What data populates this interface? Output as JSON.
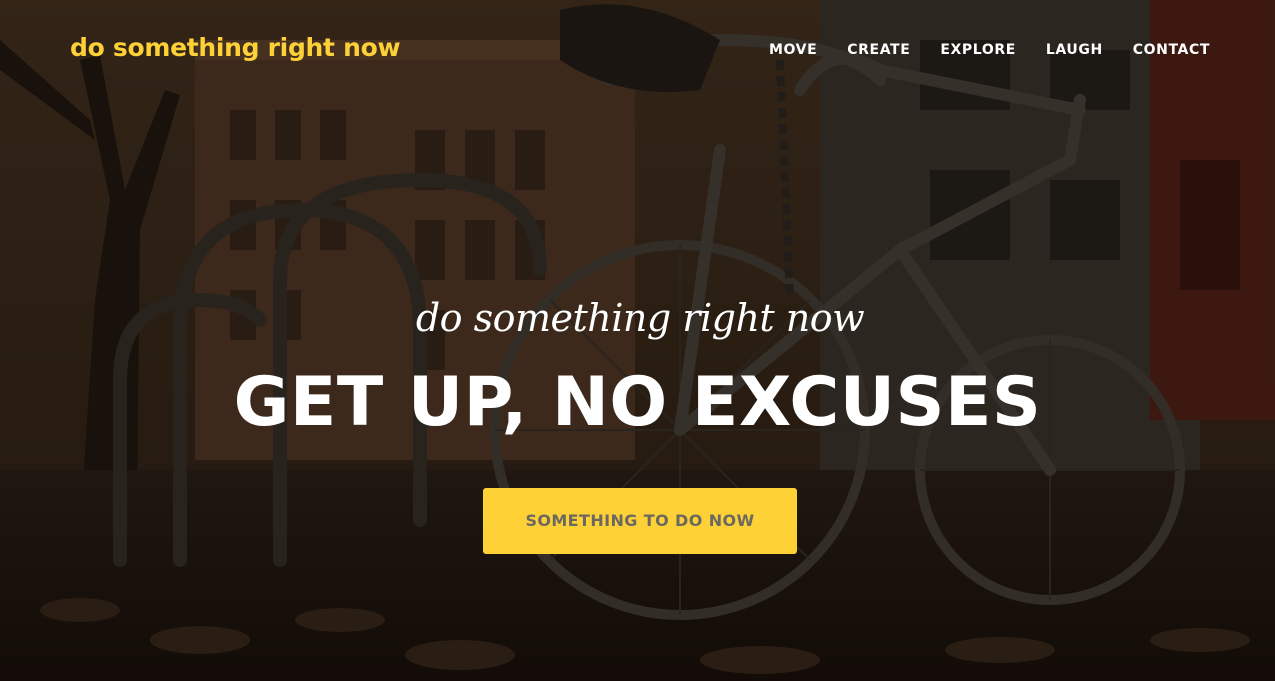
{
  "brand": {
    "name": "do something right now",
    "color": "#fed136"
  },
  "nav": {
    "items": [
      {
        "label": "MOVE"
      },
      {
        "label": "CREATE"
      },
      {
        "label": "EXPLORE"
      },
      {
        "label": "LAUGH"
      },
      {
        "label": "CONTACT"
      }
    ]
  },
  "hero": {
    "subheading": "do something right now",
    "heading": "GET UP, NO EXCUSES",
    "cta_label": "SOMETHING TO DO NOW",
    "cta_color": "#fed136",
    "background_image": "bicycle-parked-by-rail-street-photo"
  }
}
